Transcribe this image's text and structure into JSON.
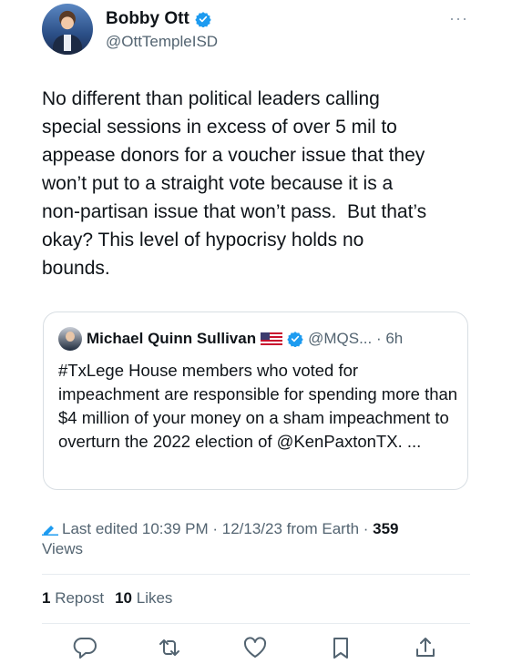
{
  "author": {
    "name": "Bobby Ott",
    "handle": "@OttTempleISD"
  },
  "more_label": "···",
  "tweet": {
    "text": "No different than political leaders calling\nspecial sessions in excess of over 5 mil to\nappease donors for a voucher issue that they\nwon’t put to a straight vote because it is a\nnon-partisan issue that won’t pass.  But that’s\nokay? This level of hypocrisy holds no\nbounds."
  },
  "quote": {
    "name": "Michael Quinn Sullivan",
    "handle_time": "@MQS... · 6h",
    "text": "#TxLege House members who voted for impeachment are responsible for spending more than $4 million of your money on a sham impeachment to overturn the 2022 election of @KenPaxtonTX. ..."
  },
  "meta": {
    "edited": "Last edited 10:39 PM · 12/13/23  from Earth · ",
    "views_count": "359",
    "views_label": "Views"
  },
  "stats": {
    "reposts_count": "1",
    "reposts_label": "Repost",
    "likes_count": "10",
    "likes_label": "Likes"
  },
  "colors": {
    "verified": "#1d9bf0",
    "secondary_text": "#536471",
    "primary_text": "#0f1419"
  },
  "icons": [
    "verified-badge-icon",
    "us-flag-icon",
    "pencil-icon",
    "reply-icon",
    "repost-icon",
    "like-icon",
    "bookmark-icon",
    "share-icon"
  ]
}
